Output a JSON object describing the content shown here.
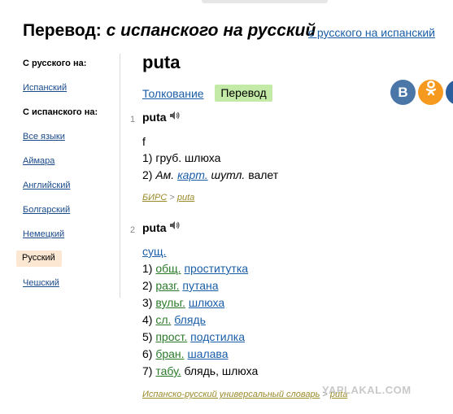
{
  "header": {
    "title_prefix": "Перевод:",
    "title_direction": "с испанского на русский",
    "switch_link": "с русского на испанский"
  },
  "sidebar": {
    "from_russian_heading": "С русского на:",
    "from_russian_items": [
      "Испанский"
    ],
    "from_spanish_heading": "С испанского на:",
    "from_spanish_items": [
      "Все языки",
      "Аймара",
      "Английский",
      "Болгарский",
      "Немецкий",
      "Русский",
      "Чешский"
    ],
    "active_item": "Русский"
  },
  "word": "puta",
  "tabs": {
    "explanation": "Толкование",
    "translation": "Перевод"
  },
  "social": {
    "vk": "В",
    "ok": "ок"
  },
  "entries": [
    {
      "number": "1",
      "headword": "puta",
      "gender": "f",
      "lines": [
        {
          "num": "1)",
          "label": "груб.",
          "text": "шлюха"
        },
        {
          "num": "2)",
          "label_ital": "Ам.",
          "label_link": "карт.",
          "label_ital2": "шутл.",
          "text": "валет"
        }
      ],
      "source": {
        "name": "БИРС",
        "sep": ">",
        "word": "puta"
      }
    },
    {
      "number": "2",
      "headword": "puta",
      "pos": "сущ.",
      "lines": [
        {
          "num": "1)",
          "label": "общ.",
          "text": "проститутка"
        },
        {
          "num": "2)",
          "label": "разг.",
          "text": "путана"
        },
        {
          "num": "3)",
          "label": "вульг.",
          "text": "шлюха"
        },
        {
          "num": "4)",
          "label": "сл.",
          "text": "блядь"
        },
        {
          "num": "5)",
          "label": "прост.",
          "text": "подстилка"
        },
        {
          "num": "6)",
          "label": "бран.",
          "text": "шалава"
        },
        {
          "num": "7)",
          "label": "табу.",
          "text": "блядь, шлюха"
        }
      ],
      "source": {
        "name": "Испанско-русский универсальный словарь",
        "sep": ">",
        "word": "puta"
      }
    }
  ],
  "watermark": "YAPLAKAL.COM",
  "colors": {
    "link": "#1a5ea8",
    "active_tab": "#c3eaa6",
    "active_sidebar": "#fbe7d2",
    "vk": "#4a76a8",
    "ok": "#f59a1f"
  }
}
